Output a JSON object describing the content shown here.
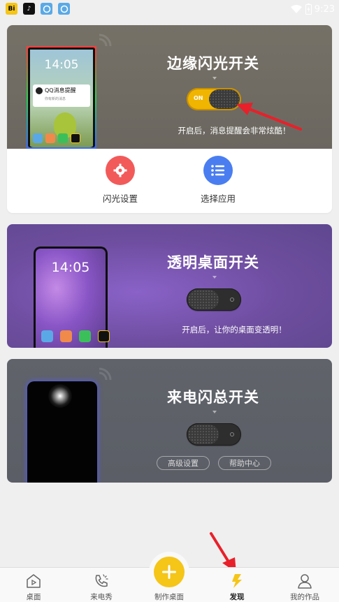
{
  "status_bar": {
    "apps": [
      {
        "icon": "bi-app-icon",
        "text": "Bi",
        "color": "#f5c518"
      },
      {
        "icon": "tiktok-icon",
        "text": "♪",
        "color": "#111111"
      },
      {
        "icon": "qq-browser-icon",
        "text": "",
        "color": "#5aa9e6"
      },
      {
        "icon": "qq-browser-icon-2",
        "text": "",
        "color": "#5aa9e6"
      }
    ],
    "time": "9:23"
  },
  "edge_flash": {
    "title": "边缘闪光开关",
    "switch_label": "ON",
    "switch_state": "on",
    "description": "开启后，消息提醒会非常炫酷！",
    "preview": {
      "time": "14:05",
      "notification_title": "QQ消息提醒",
      "notification_body": "你有新的消息"
    },
    "actions": [
      {
        "label": "闪光设置",
        "icon": "gear-icon",
        "color": "#f25a5a"
      },
      {
        "label": "选择应用",
        "icon": "list-icon",
        "color": "#4a7ef0"
      }
    ]
  },
  "transparent_desktop": {
    "title": "透明桌面开关",
    "switch_state": "off",
    "description": "开启后，让你的桌面变透明！",
    "preview": {
      "time": "14:05"
    }
  },
  "call_flash": {
    "title": "来电闪总开关",
    "switch_state": "off",
    "buttons": [
      "高级设置",
      "帮助中心"
    ]
  },
  "tab_bar": {
    "tabs": [
      {
        "label": "桌面",
        "icon": "desktop-icon"
      },
      {
        "label": "来电秀",
        "icon": "phone-icon"
      },
      {
        "label": "制作桌面",
        "icon": "plus-icon"
      },
      {
        "label": "发现",
        "icon": "lightning-icon",
        "active": true
      },
      {
        "label": "我的作品",
        "icon": "person-icon"
      }
    ],
    "accent_color": "#f5c518"
  }
}
